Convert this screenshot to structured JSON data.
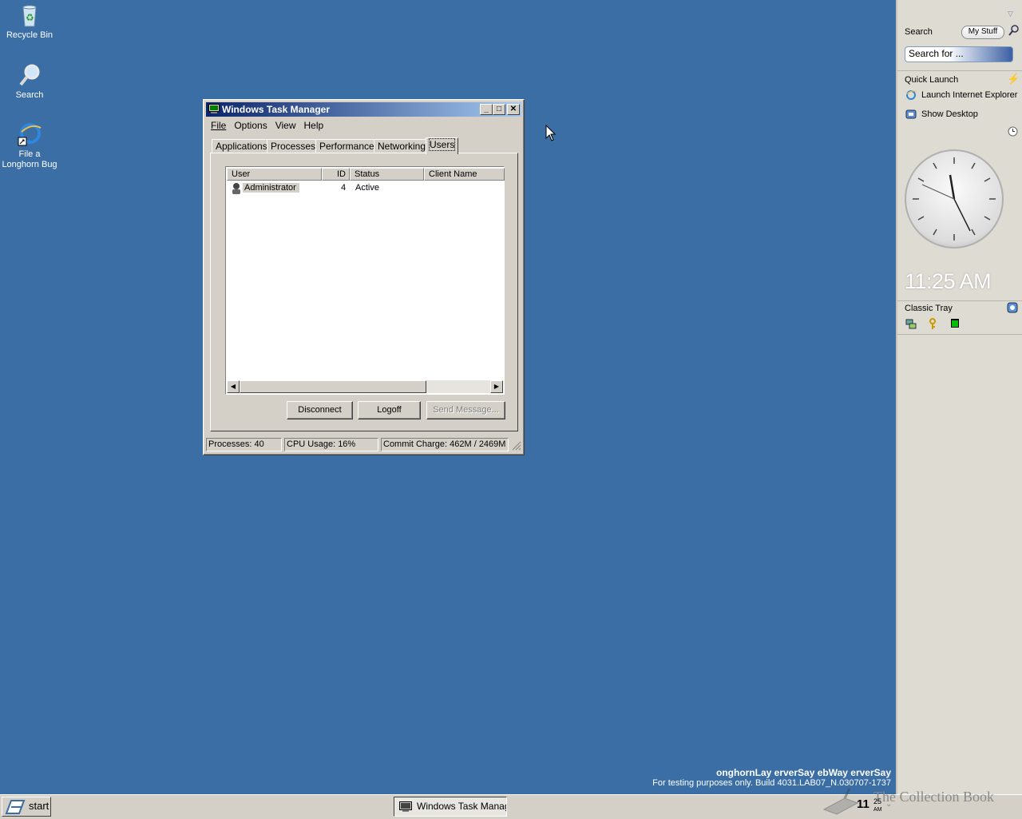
{
  "desktop": {
    "icons": [
      {
        "label": "Recycle Bin"
      },
      {
        "label": "Search"
      },
      {
        "label": "File a Longhorn Bug"
      }
    ]
  },
  "window": {
    "title": "Windows Task Manager",
    "menu": [
      "File",
      "Options",
      "View",
      "Help"
    ],
    "tabs": [
      "Applications",
      "Processes",
      "Performance",
      "Networking",
      "Users"
    ],
    "active_tab": "Users",
    "columns": [
      "User",
      "ID",
      "Status",
      "Client Name"
    ],
    "rows": [
      {
        "user": "Administrator",
        "id": "4",
        "status": "Active",
        "client": ""
      }
    ],
    "buttons": {
      "disconnect": "Disconnect",
      "logoff": "Logoff",
      "send_message": "Send Message..."
    },
    "status": {
      "processes": "Processes: 40",
      "cpu": "CPU Usage: 16%",
      "commit": "Commit Charge: 462M / 2469M"
    }
  },
  "sidebar": {
    "search_title": "Search",
    "my_stuff": "My Stuff",
    "search_placeholder": "Search for ...",
    "quick_launch_title": "Quick Launch",
    "quick_launch_items": [
      "Launch Internet Explorer",
      "Show Desktop"
    ],
    "clock_time": "11:25 AM",
    "classic_tray_title": "Classic Tray"
  },
  "taskbar": {
    "start_label": "start",
    "task_label": "Windows Task Manager",
    "tray_time_hour": "11",
    "tray_time_min": "25",
    "tray_ampm": "AM"
  },
  "watermark": {
    "line1": "onghornLay erverSay ebWay erverSay",
    "line2": "For testing purposes only. Build 4031.LAB07_N.030707-1737",
    "line3": "The Collection Book"
  },
  "colors": {
    "desktop": "#3a6ea5",
    "title_active": "#0a246a"
  }
}
